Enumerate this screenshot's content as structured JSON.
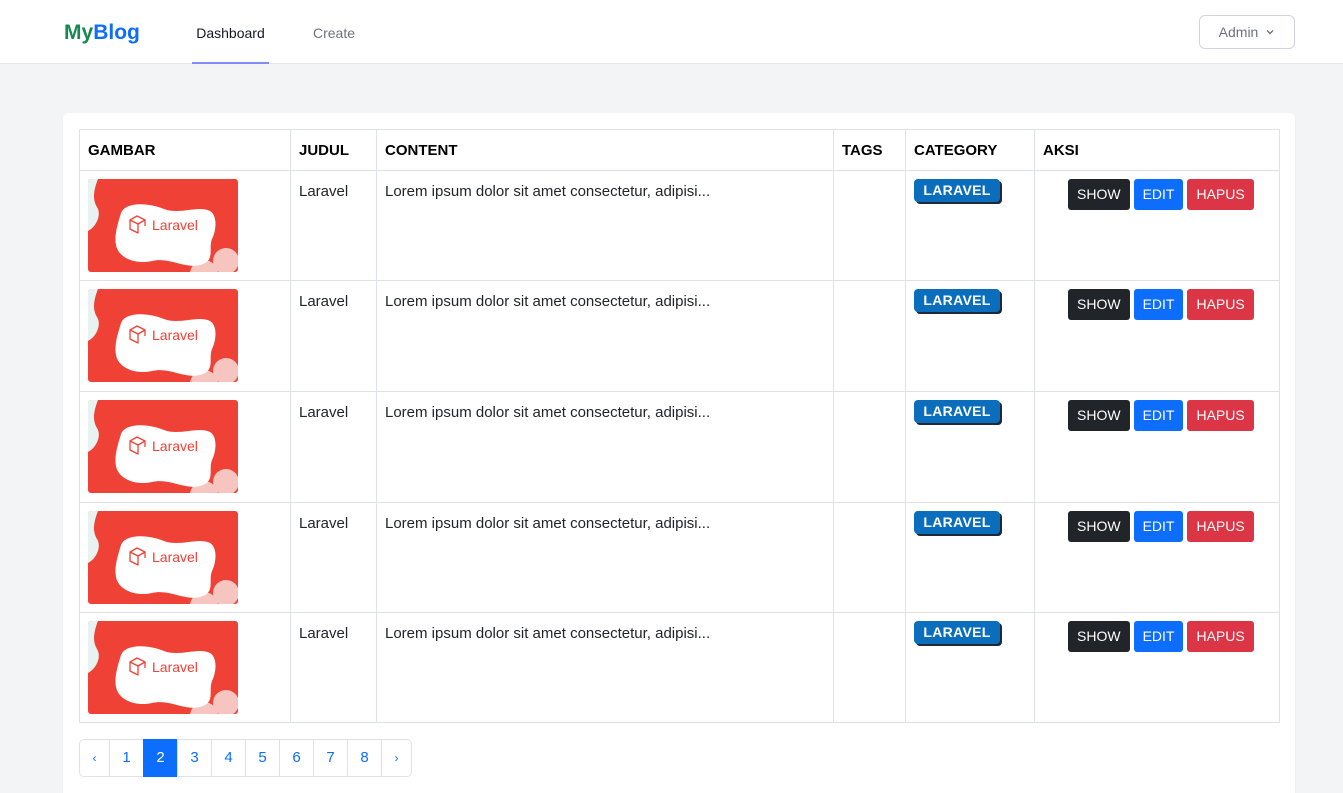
{
  "brand": {
    "part1": "My",
    "part2": "Blog"
  },
  "nav": {
    "dashboard": "Dashboard",
    "create": "Create"
  },
  "user_menu": {
    "label": "Admin"
  },
  "table": {
    "headers": [
      "GAMBAR",
      "JUDUL",
      "CONTENT",
      "TAGS",
      "CATEGORY",
      "AKSI"
    ],
    "rows": [
      {
        "image_label": "Laravel",
        "judul": "Laravel",
        "content": "Lorem ipsum dolor sit amet consectetur, adipisi...",
        "tags": "",
        "category": "LARAVEL"
      },
      {
        "image_label": "Laravel",
        "judul": "Laravel",
        "content": "Lorem ipsum dolor sit amet consectetur, adipisi...",
        "tags": "",
        "category": "LARAVEL"
      },
      {
        "image_label": "Laravel",
        "judul": "Laravel",
        "content": "Lorem ipsum dolor sit amet consectetur, adipisi...",
        "tags": "",
        "category": "LARAVEL"
      },
      {
        "image_label": "Laravel",
        "judul": "Laravel",
        "content": "Lorem ipsum dolor sit amet consectetur, adipisi...",
        "tags": "",
        "category": "LARAVEL"
      },
      {
        "image_label": "Laravel",
        "judul": "Laravel",
        "content": "Lorem ipsum dolor sit amet consectetur, adipisi...",
        "tags": "",
        "category": "LARAVEL"
      }
    ],
    "actions": {
      "show": "SHOW",
      "edit": "EDIT",
      "hapus": "HAPUS"
    }
  },
  "pagination": {
    "prev": "‹",
    "next": "›",
    "pages": [
      "1",
      "2",
      "3",
      "4",
      "5",
      "6",
      "7",
      "8"
    ],
    "current": "2"
  },
  "colors": {
    "brand_green": "#198754",
    "brand_blue": "#0d6efd",
    "laravel_red": "#ef4135",
    "badge_blue": "#0a6ebd",
    "show_dark": "#212529",
    "edit_blue": "#0d6efd",
    "hapus_red": "#dc3545"
  }
}
